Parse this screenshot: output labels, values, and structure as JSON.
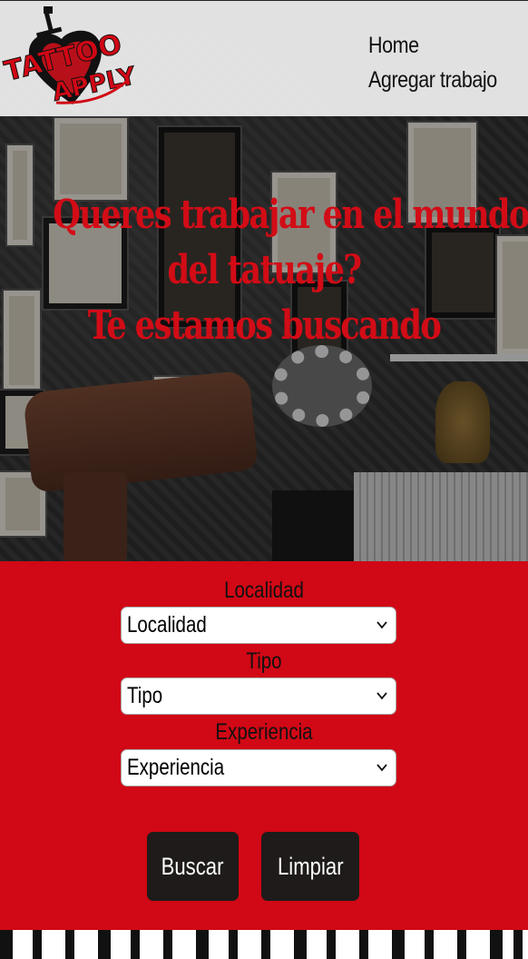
{
  "header": {
    "logo": {
      "line1": "TATTOO",
      "line2": "APPLY",
      "icon": "heart-dagger-logo"
    },
    "nav": [
      {
        "label": "Home"
      },
      {
        "label": "Agregar trabajo"
      }
    ]
  },
  "hero": {
    "title_lines": [
      "Queres trabajar en el mundo",
      "del tatuaje?",
      "Te estamos buscando"
    ]
  },
  "filters": {
    "localidad": {
      "label": "Localidad",
      "selected": "Localidad"
    },
    "tipo": {
      "label": "Tipo",
      "selected": "Tipo"
    },
    "experiencia": {
      "label": "Experiencia",
      "selected": "Experiencia"
    }
  },
  "actions": {
    "search_label": "Buscar",
    "clear_label": "Limpiar"
  },
  "colors": {
    "brand_red": "#d10815",
    "button_dark": "#1e1b1a",
    "header_bg": "#f0f0f0"
  }
}
